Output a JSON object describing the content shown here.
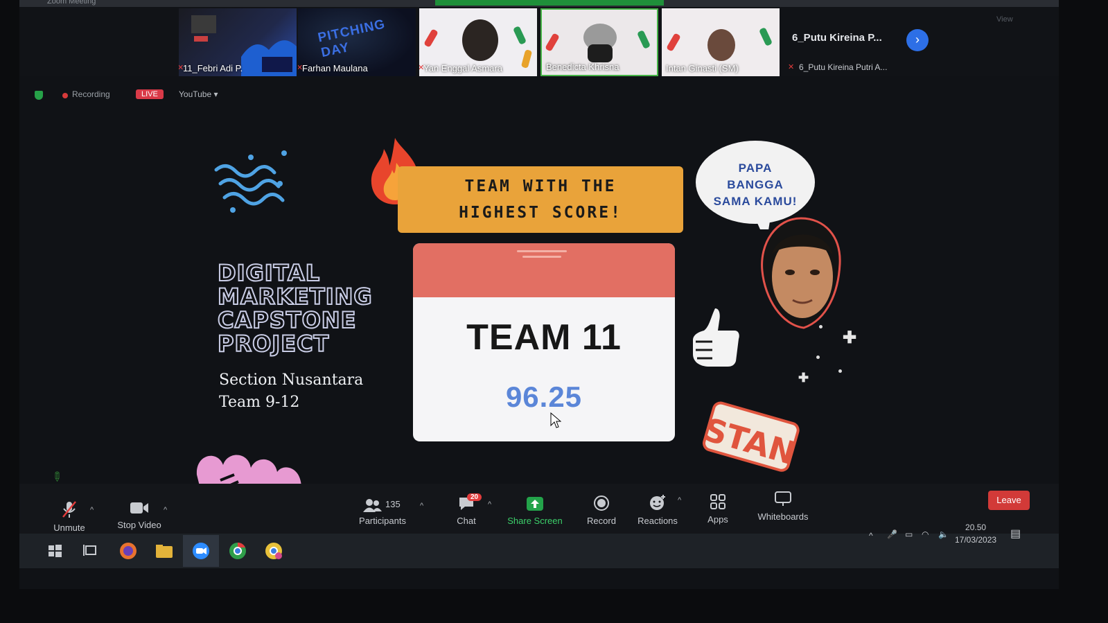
{
  "window": {
    "title": "Zoom Meeting"
  },
  "participants_strip": [
    {
      "name": "11_Febri Adi P."
    },
    {
      "name": "Farhan Maulana"
    },
    {
      "name": "Yan Enggal Asmara"
    },
    {
      "name": "Benedicta Khrisna"
    },
    {
      "name": "Intan Ginasti (SM)"
    }
  ],
  "extra_participant": {
    "title": "6_Putu Kireina P...",
    "name": "6_Putu Kireina Putri A..."
  },
  "poster_text": {
    "pitching_day": "PITCHING DAY"
  },
  "recording": {
    "label": "Recording",
    "live": "LIVE",
    "stream": "YouTube"
  },
  "view_label": "View",
  "slide": {
    "title_lines": [
      "DIGITAL",
      "MARKETING",
      "CAPSTONE",
      "PROJECT"
    ],
    "section_lines": [
      "Section Nusantara",
      "Team 9-12"
    ],
    "banner_lines": [
      "TEAM WITH THE",
      "HIGHEST SCORE!"
    ],
    "team": "TEAM 11",
    "score": "96.25",
    "bubble_lines": [
      "PAPA",
      "BANGGA",
      "SAMA KAMU!"
    ],
    "sticker": "STAN"
  },
  "toolbar": {
    "unmute": "Unmute",
    "stop_video": "Stop Video",
    "participants": "Participants",
    "participants_count": "135",
    "chat": "Chat",
    "chat_badge": "20",
    "share_screen": "Share Screen",
    "record": "Record",
    "reactions": "Reactions",
    "apps": "Apps",
    "whiteboards": "Whiteboards",
    "leave": "Leave"
  },
  "taskbar": {
    "time": "20.50",
    "date": "17/03/2023",
    "apps": [
      "windows-start",
      "task-view",
      "firefox",
      "file-explorer",
      "zoom",
      "chrome",
      "chrome-profile"
    ]
  },
  "colors": {
    "accent_blue": "#2d6fe6",
    "live_red": "#d93a48",
    "banner_orange": "#e9a33a",
    "card_red": "#e26f63",
    "score_blue": "#5b86d8",
    "share_green": "#23a34a"
  }
}
